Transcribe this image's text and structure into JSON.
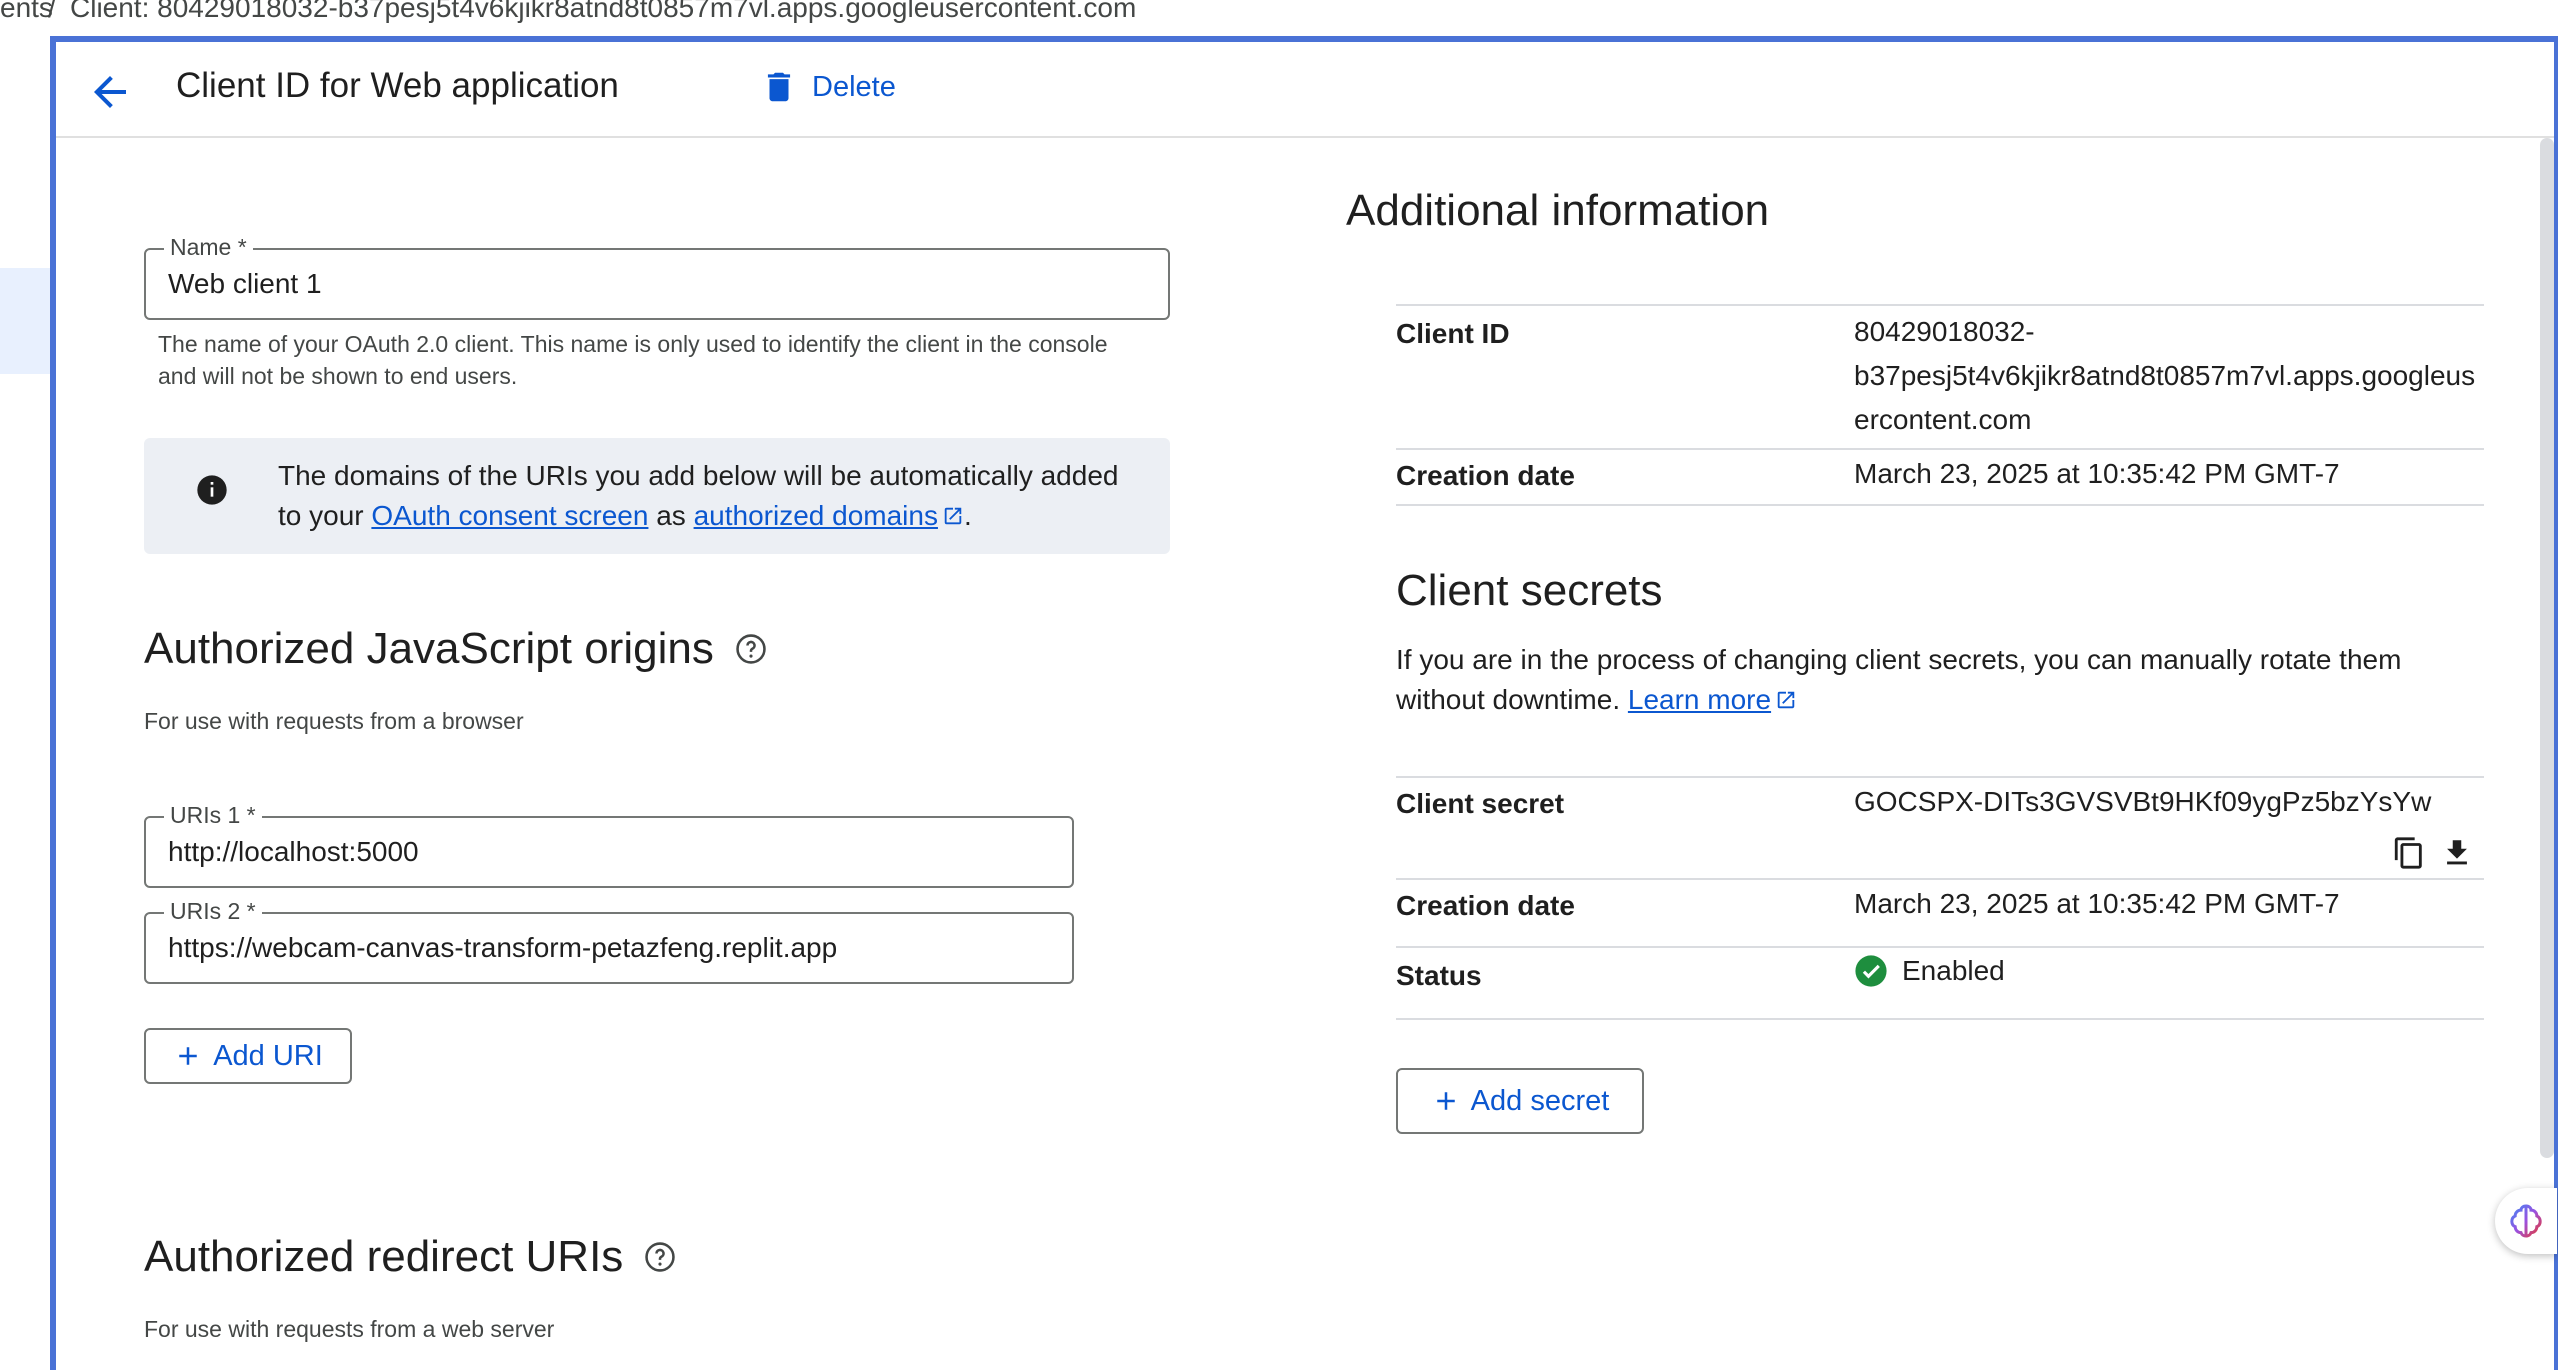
{
  "breadcrumb": {
    "parent": "ents",
    "separator": "/",
    "current": "Client: 80429018032-b37pesj5t4v6kjikr8atnd8t0857m7vl.apps.googleusercontent.com"
  },
  "header": {
    "title": "Client ID for Web application",
    "delete_label": "Delete",
    "back_icon": "arrow-back-icon",
    "delete_icon": "trash-icon"
  },
  "name_field": {
    "label": "Name *",
    "value": "Web client 1",
    "hint": "The name of your OAuth 2.0 client. This name is only used to identify the client in the console and will not be shown to end users."
  },
  "notice": {
    "text_before": "The domains of the URIs you add below will be automatically added to your ",
    "link1": "OAuth consent screen",
    "text_middle": " as ",
    "link2": "authorized domains",
    "text_after": "."
  },
  "js_origins": {
    "title": "Authorized JavaScript origins",
    "subtitle": "For use with requests from a browser",
    "uris": [
      {
        "label": "URIs 1 *",
        "value": "http://localhost:5000"
      },
      {
        "label": "URIs 2 *",
        "value": "https://webcam-canvas-transform-petazfeng.replit.app"
      }
    ],
    "add_label": "Add URI"
  },
  "redirect": {
    "title": "Authorized redirect URIs",
    "subtitle": "For use with requests from a web server"
  },
  "additional_info": {
    "title": "Additional information",
    "client_id_key": "Client ID",
    "client_id_line1": "80429018032-",
    "client_id_line2": "b37pesj5t4v6kjikr8atnd8t0857m7vl.apps.googleus",
    "client_id_line3": "ercontent.com",
    "creation_key": "Creation date",
    "creation_value": "March 23, 2025 at 10:35:42 PM GMT-7"
  },
  "client_secrets": {
    "title": "Client secrets",
    "desc_before": "If you are in the process of changing client secrets, you can manually rotate them without downtime. ",
    "learn_more": "Learn more",
    "secret_key": "Client secret",
    "secret_value": "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",
    "creation_key": "Creation date",
    "creation_value": "March 23, 2025 at 10:35:42 PM GMT-7",
    "status_key": "Status",
    "status_value": "Enabled",
    "add_label": "Add secret"
  },
  "colors": {
    "accent": "#0b57d0",
    "panel_border": "#4a72d6",
    "status_green": "#1e8e3e",
    "info_bg": "#eceff4"
  }
}
